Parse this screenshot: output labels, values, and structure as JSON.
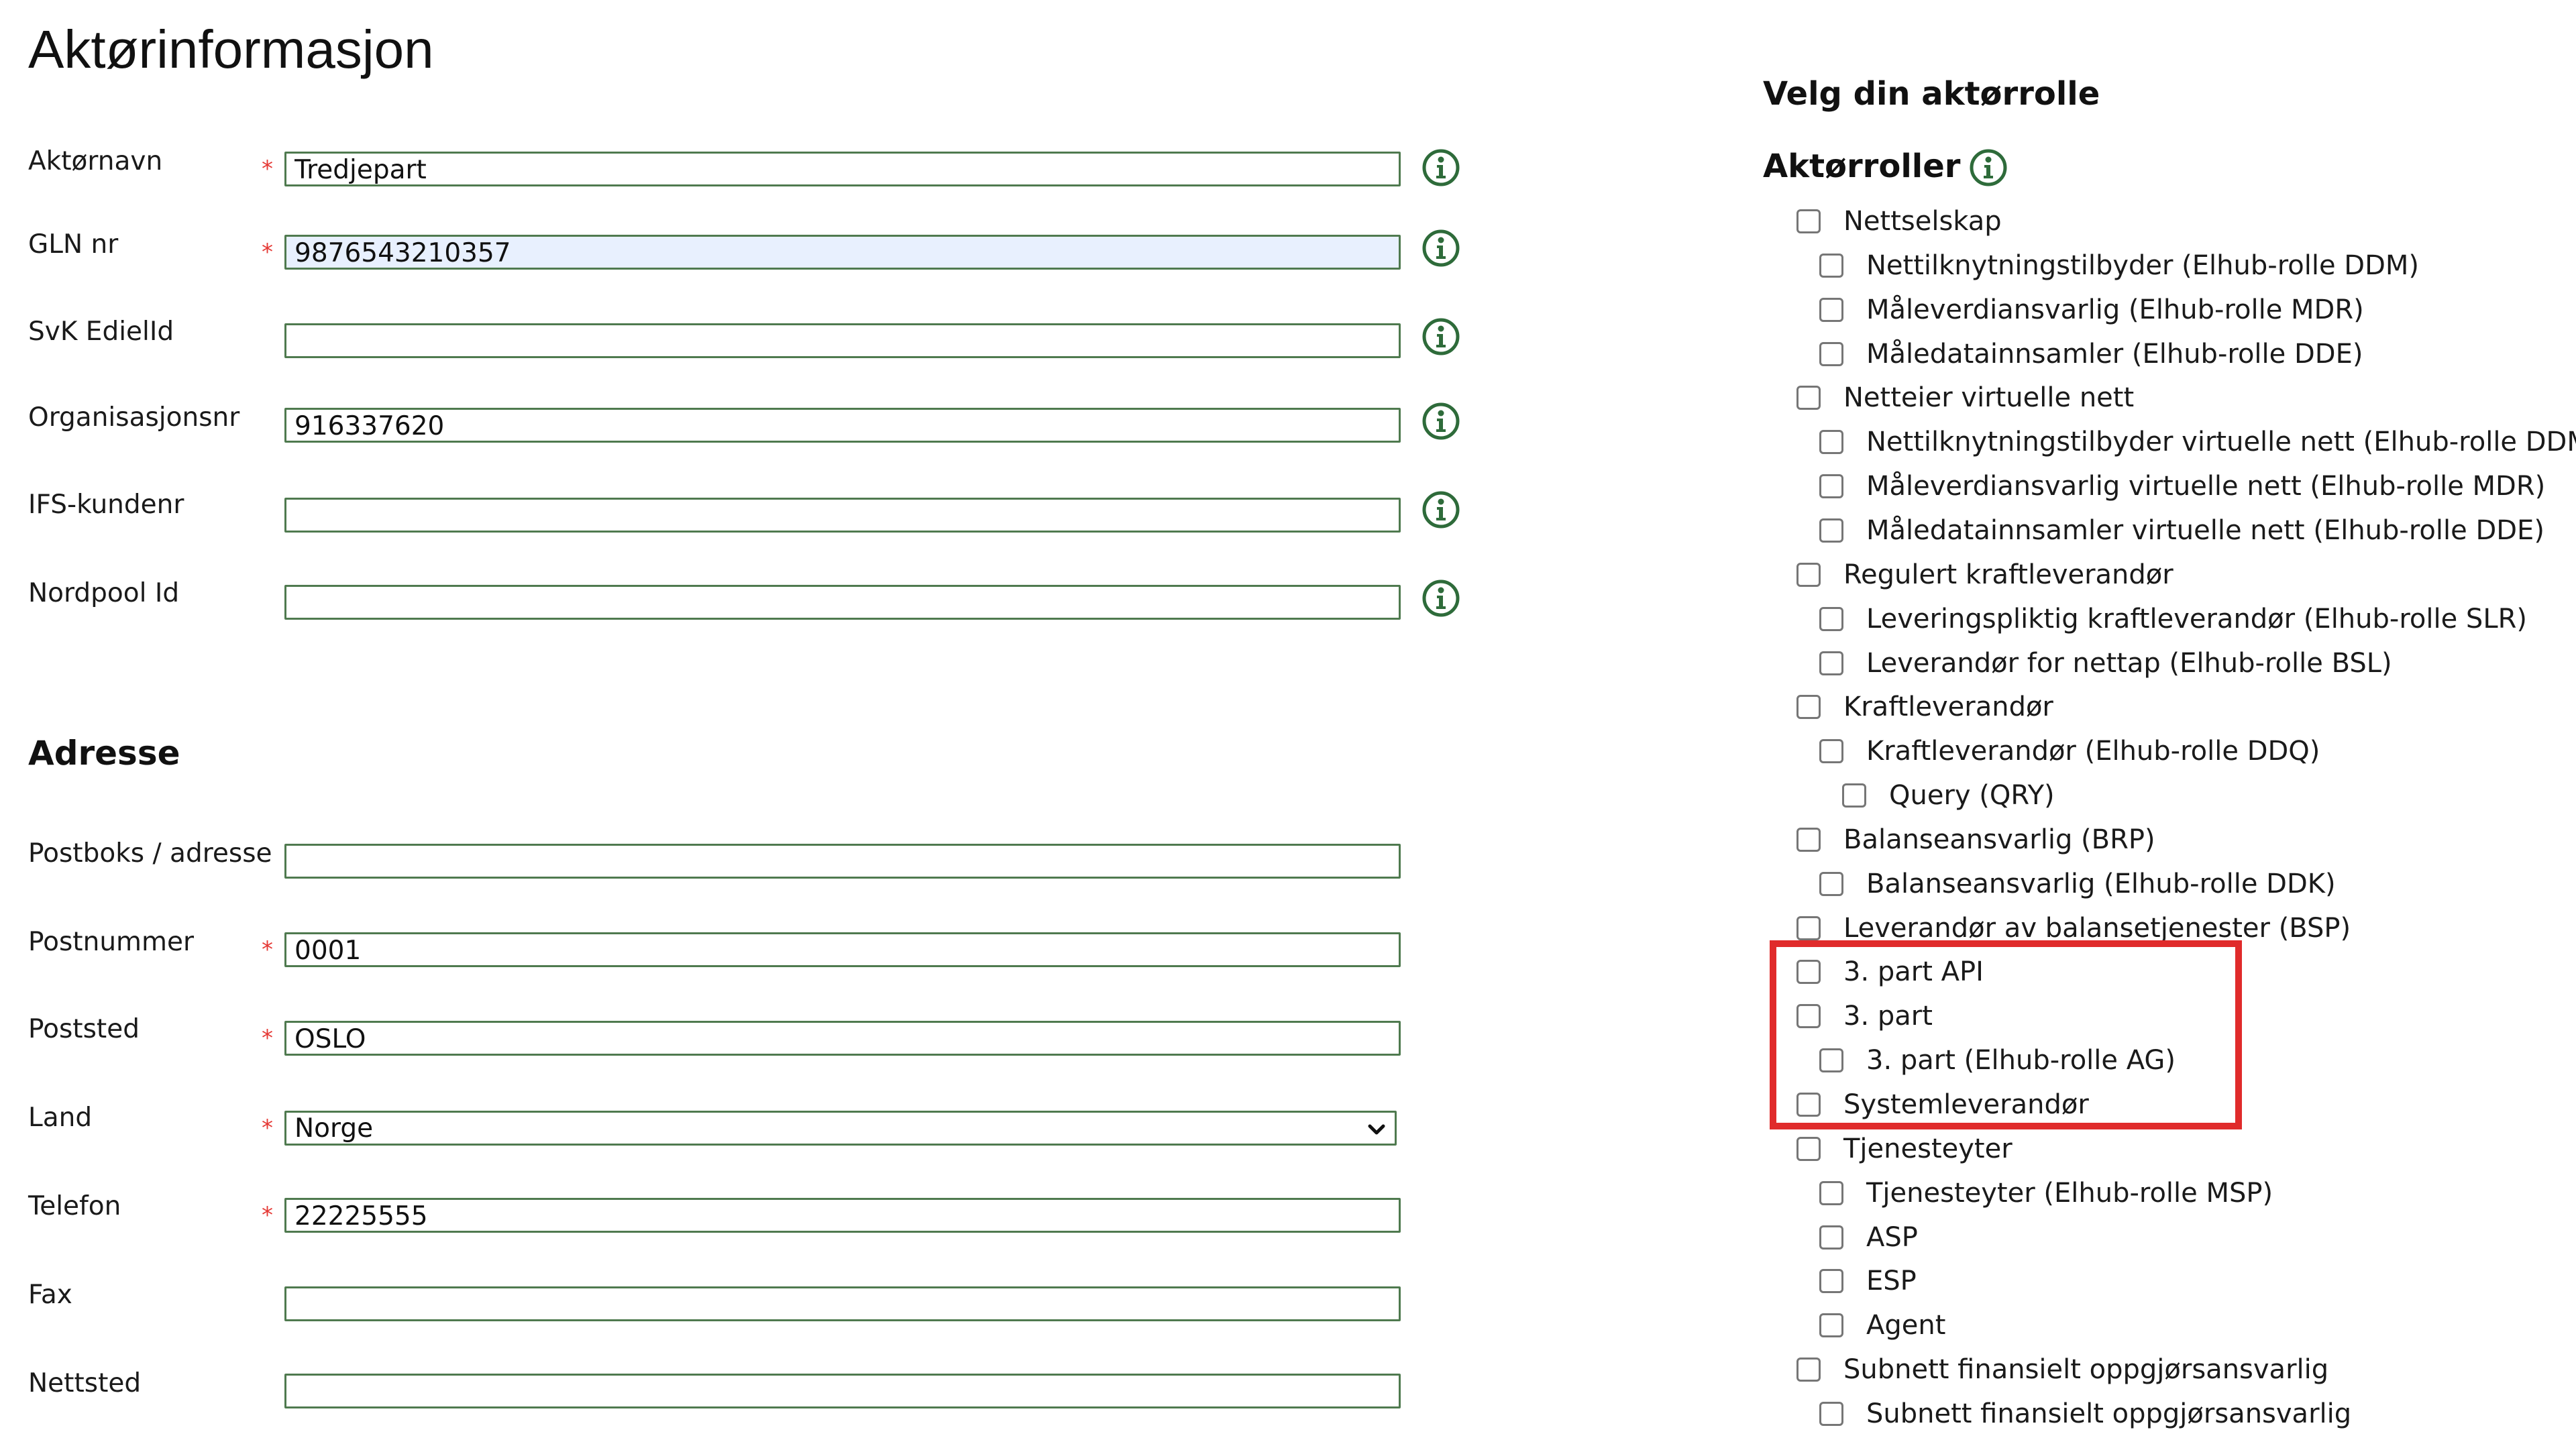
{
  "title": "Aktørinformasjon",
  "required_marker": "*",
  "actor_fields": [
    {
      "label": "Aktørnavn",
      "value": "Tredjepart",
      "required": true
    },
    {
      "label": "GLN nr",
      "value": "9876543210357",
      "required": true,
      "autofilled": true
    },
    {
      "label": "SvK EdielId",
      "value": "",
      "required": false
    },
    {
      "label": "Organisasjonsnr",
      "value": "916337620",
      "required": false
    },
    {
      "label": "IFS-kundenr",
      "value": "",
      "required": false
    },
    {
      "label": "Nordpool Id",
      "value": "",
      "required": false
    }
  ],
  "address_heading": "Adresse",
  "address_fields": [
    {
      "label": "Postboks / adresse",
      "value": ""
    },
    {
      "label": "Postnummer",
      "value": "0001",
      "required": true
    },
    {
      "label": "Poststed",
      "value": "OSLO",
      "required": true
    },
    {
      "label": "Land",
      "value": "Norge",
      "required": true,
      "type": "select"
    },
    {
      "label": "Telefon",
      "value": "22225555",
      "required": true
    },
    {
      "label": "Fax",
      "value": ""
    },
    {
      "label": "Nettsted",
      "value": ""
    }
  ],
  "right_heading": "Velg din aktørrolle",
  "roles_heading": "Aktørroller",
  "roles": [
    {
      "label": "Nettselskap",
      "level": 0,
      "checked": false
    },
    {
      "label": "Nettilknytningstilbyder (Elhub-rolle DDM)",
      "level": 1,
      "checked": false
    },
    {
      "label": "Måleverdiansvarlig (Elhub-rolle MDR)",
      "level": 1,
      "checked": false
    },
    {
      "label": "Måledatainnsamler (Elhub-rolle DDE)",
      "level": 1,
      "checked": false
    },
    {
      "label": "Netteier virtuelle nett",
      "level": 0,
      "checked": false
    },
    {
      "label": "Nettilknytningstilbyder virtuelle nett (Elhub-rolle DDM)",
      "level": 1,
      "checked": false
    },
    {
      "label": "Måleverdiansvarlig virtuelle nett (Elhub-rolle MDR)",
      "level": 1,
      "checked": false
    },
    {
      "label": "Måledatainnsamler virtuelle nett (Elhub-rolle DDE)",
      "level": 1,
      "checked": false
    },
    {
      "label": "Regulert kraftleverandør",
      "level": 0,
      "checked": false
    },
    {
      "label": "Leveringspliktig kraftleverandør (Elhub-rolle SLR)",
      "level": 1,
      "checked": false
    },
    {
      "label": "Leverandør for nettap (Elhub-rolle BSL)",
      "level": 1,
      "checked": false
    },
    {
      "label": "Kraftleverandør",
      "level": 0,
      "checked": false
    },
    {
      "label": "Kraftleverandør (Elhub-rolle DDQ)",
      "level": 1,
      "checked": false
    },
    {
      "label": "Query (QRY)",
      "level": 2,
      "checked": false
    },
    {
      "label": "Balanseansvarlig (BRP)",
      "level": 0,
      "checked": false
    },
    {
      "label": "Balanseansvarlig (Elhub-rolle DDK)",
      "level": 1,
      "checked": false
    },
    {
      "label": "Leverandør av balansetjenester (BSP)",
      "level": 0,
      "checked": false
    },
    {
      "label": "3. part API",
      "level": 0,
      "checked": false
    },
    {
      "label": "3. part",
      "level": 0,
      "checked": false
    },
    {
      "label": "3. part (Elhub-rolle AG)",
      "level": 1,
      "checked": false
    },
    {
      "label": "Systemleverandør",
      "level": 0,
      "checked": false
    },
    {
      "label": "Tjenesteyter",
      "level": 0,
      "checked": false
    },
    {
      "label": "Tjenesteyter (Elhub-rolle MSP)",
      "level": 1,
      "checked": false
    },
    {
      "label": "ASP",
      "level": 1,
      "checked": false
    },
    {
      "label": "ESP",
      "level": 1,
      "checked": false
    },
    {
      "label": "Agent",
      "level": 1,
      "checked": false
    },
    {
      "label": "Subnett finansielt oppgjørsansvarlig",
      "level": 0,
      "checked": false
    },
    {
      "label": "Subnett finansielt oppgjørsansvarlig",
      "level": 1,
      "checked": false
    }
  ],
  "highlight_color": "#e02b2b",
  "field_border_color": "#4f7a4f",
  "info_icon_color": "#2e6b3a",
  "icons": {
    "info": "info-circle-icon",
    "select": "chevron-down-icon"
  }
}
